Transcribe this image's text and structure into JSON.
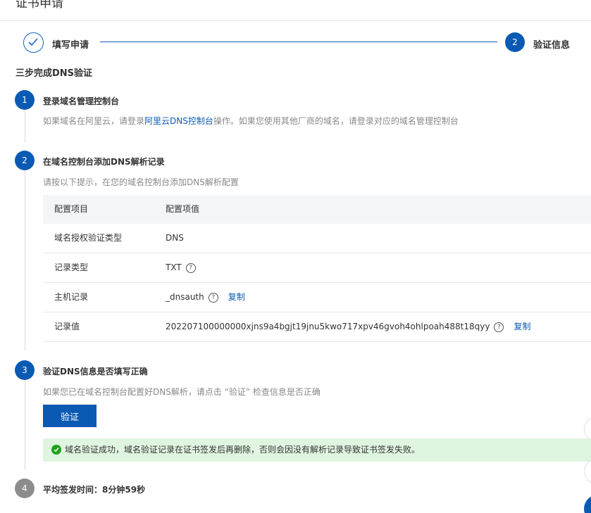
{
  "page": {
    "title": "证书申请"
  },
  "stepper": {
    "step1": {
      "label": "填写申请"
    },
    "step2": {
      "number": "2",
      "label": "验证信息"
    }
  },
  "section_title": "三步完成DNS验证",
  "steps": [
    {
      "number": "1",
      "title": "登录域名管理控制台",
      "desc_prefix": "如果域名在阿里云，请登录",
      "desc_link": "阿里云DNS控制台",
      "desc_suffix": "操作。如果您使用其他厂商的域名，请登录对应的域名管理控制台"
    },
    {
      "number": "2",
      "title": "在域名控制台添加DNS解析记录",
      "desc": "请按以下提示，在您的域名控制台添加DNS解析配置"
    },
    {
      "number": "3",
      "title": "验证DNS信息是否填写正确",
      "desc": "如果您已在域名控制台配置好DNS解析，请点击 “验证” 检查信息是否正确"
    },
    {
      "number": "4",
      "title_label": "平均签发时间：",
      "title_value": "8分钟59秒"
    }
  ],
  "table": {
    "headers": [
      "配置项目",
      "配置项值"
    ],
    "rows": [
      {
        "item": "域名授权验证类型",
        "value": "DNS"
      },
      {
        "item": "记录类型",
        "value": "TXT"
      },
      {
        "item": "主机记录",
        "value": "_dnsauth",
        "copy": "复制"
      },
      {
        "item": "记录值",
        "value": "202207100000000xjns9a4bgjt19jnu5kwo717xpv46gvoh4ohlpoah488t18qyy",
        "copy": "复制"
      }
    ]
  },
  "verify_button": "验证",
  "success_message": "域名验证成功，域名验证记录在证书签发后再删除，否则会因没有解析记录导致证书签发失败。",
  "icons": {
    "help": "?"
  },
  "colors": {
    "primary": "#0a5ab4",
    "success_bg": "#dff5df",
    "success_icon": "#1fa01f",
    "muted": "#888888"
  }
}
